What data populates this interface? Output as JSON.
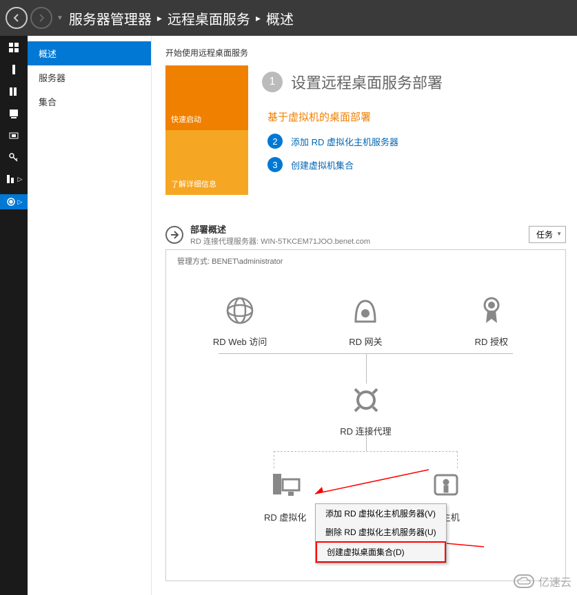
{
  "breadcrumb": {
    "a": "服务器管理器",
    "b": "远程桌面服务",
    "c": "概述"
  },
  "sidebar": {
    "items": [
      "概述",
      "服务器",
      "集合"
    ]
  },
  "content": {
    "start_title": "开始使用远程桌面服务",
    "tile_quick": "快速启动",
    "tile_learn": "了解详细信息",
    "heading": "设置远程桌面服务部署",
    "sub": "基于虚拟机的桌面部署",
    "step2": "添加 RD 虚拟化主机服务器",
    "step3": "创建虚拟机集合"
  },
  "deploy": {
    "title": "部署概述",
    "broker_label": "RD 连接代理服务器:",
    "broker_server": "WIN-5TKCEM71JOO.benet.com",
    "tasks": "任务",
    "managed_by_label": "管理方式:",
    "managed_by": "BENET\\administrator"
  },
  "nodes": {
    "web": "RD Web 访问",
    "gateway": "RD 网关",
    "license": "RD 授权",
    "broker": "RD 连接代理",
    "virthost": "RD 虚拟化",
    "session": "话主机"
  },
  "ctx": {
    "add": "添加 RD 虚拟化主机服务器(V)",
    "del": "删除 RD 虚拟化主机服务器(U)",
    "create": "创建虚拟桌面集合(D)"
  },
  "watermark": "亿速云"
}
